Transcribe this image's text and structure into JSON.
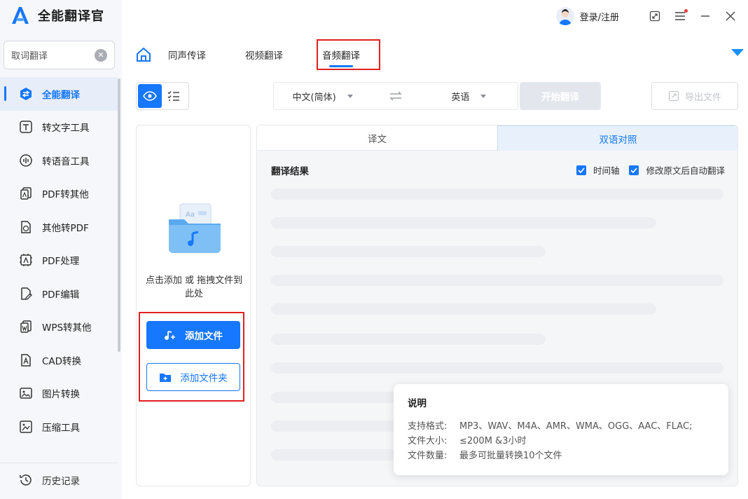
{
  "app": {
    "title": "全能翻译官",
    "brand_color": "#1677ff",
    "highlight_color": "#e02020"
  },
  "header": {
    "login_label": "登录/注册",
    "icons": [
      "avatar-icon",
      "resize-icon",
      "menu-icon",
      "minimize-icon",
      "close-icon"
    ]
  },
  "sidebar": {
    "search": {
      "value": "取词翻译",
      "placeholder": "取词翻译"
    },
    "items": [
      {
        "label": "全能翻译",
        "icon": "translate-icon",
        "active": true
      },
      {
        "label": "转文字工具",
        "icon": "text-tool-icon"
      },
      {
        "label": "转语音工具",
        "icon": "voice-tool-icon"
      },
      {
        "label": "PDF转其他",
        "icon": "pdf-convert-icon"
      },
      {
        "label": "其他转PDF",
        "icon": "to-pdf-icon"
      },
      {
        "label": "PDF处理",
        "icon": "pdf-process-icon"
      },
      {
        "label": "PDF编辑",
        "icon": "pdf-edit-icon"
      },
      {
        "label": "WPS转其他",
        "icon": "wps-icon"
      },
      {
        "label": "CAD转换",
        "icon": "cad-icon"
      },
      {
        "label": "图片转换",
        "icon": "image-icon"
      },
      {
        "label": "压缩工具",
        "icon": "compress-icon"
      }
    ],
    "history_label": "历史记录"
  },
  "tabs": {
    "items": [
      "同声传译",
      "视频翻译",
      "音频翻译"
    ],
    "active_index": 2
  },
  "toolbar": {
    "source_lang": "中文(简体)",
    "target_lang": "英语",
    "start_label": "开始翻译",
    "export_label": "导出文件"
  },
  "upload": {
    "hint": "点击添加 或 拖拽文件到此处",
    "add_file_label": "添加文件",
    "add_folder_label": "添加文件夹"
  },
  "result": {
    "tabs": [
      "译文",
      "双语对照"
    ],
    "active_tab_index": 1,
    "title": "翻译结果",
    "options": [
      {
        "label": "时间轴",
        "checked": true
      },
      {
        "label": "修改原文后自动翻译",
        "checked": true
      }
    ]
  },
  "info": {
    "title": "说明",
    "rows": [
      {
        "label": "支持格式:",
        "value": "MP3、WAV、M4A、AMR、WMA、OGG、AAC、FLAC;"
      },
      {
        "label": "文件大小:",
        "value": "≤200M &3小时"
      },
      {
        "label": "文件数量:",
        "value": "最多可批量转换10个文件"
      }
    ]
  }
}
